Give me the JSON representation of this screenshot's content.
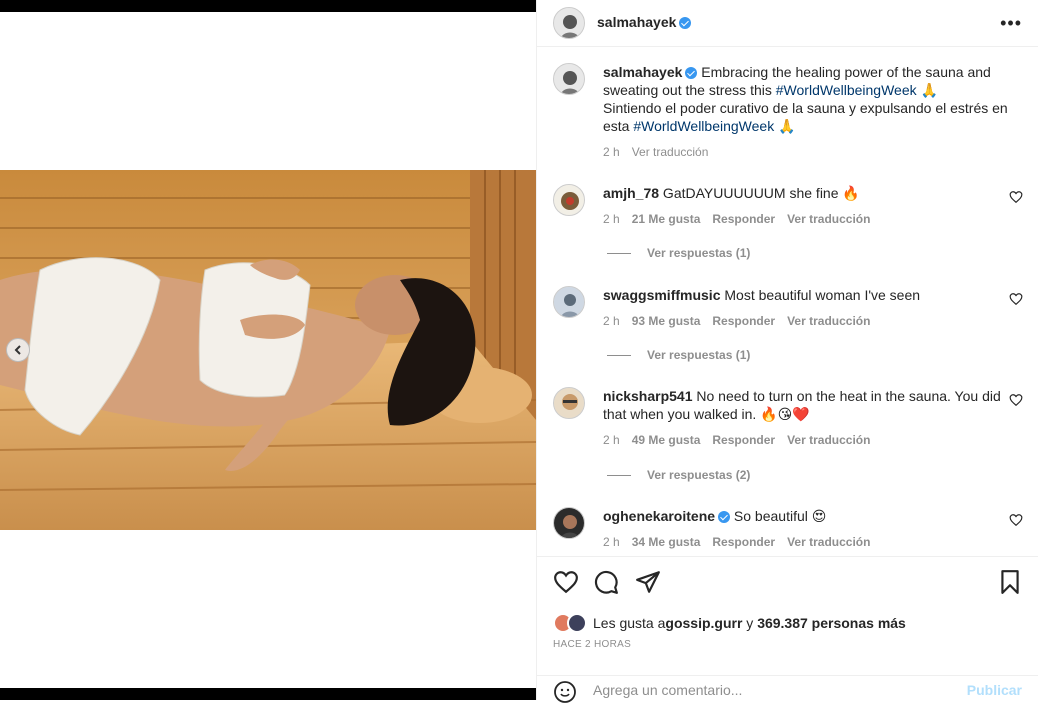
{
  "post": {
    "username": "salmahayek",
    "more_icon": "more-horizontal-icon",
    "caption_user": "salmahayek",
    "caption_text_1": " Embracing the healing power of the sauna and sweating out the stress this ",
    "caption_tag_1": "#WorldWellbeingWeek",
    "caption_emoji_1": " 🙏",
    "caption_text_2": "Sintiendo el poder curativo de la sauna y expulsando el estrés en esta ",
    "caption_tag_2": "#WorldWellbeingWeek",
    "caption_emoji_2": " 🙏",
    "caption_time": "2 h",
    "caption_translate": "Ver traducción"
  },
  "comments": [
    {
      "user": "amjh_78",
      "text": " GatDAYUUUUUUM she fine 🔥",
      "time": "2 h",
      "likes": "21 Me gusta",
      "reply": "Responder",
      "translate": "Ver traducción",
      "replies": "Ver respuestas (1)"
    },
    {
      "user": "swaggsmiffmusic",
      "text": " Most beautiful woman I've seen",
      "time": "2 h",
      "likes": "93 Me gusta",
      "reply": "Responder",
      "translate": "Ver traducción",
      "replies": "Ver respuestas (1)"
    },
    {
      "user": "nicksharp541",
      "text": " No need to turn on the heat in the sauna. You did that when you walked in. 🔥😘❤️",
      "time": "2 h",
      "likes": "49 Me gusta",
      "reply": "Responder",
      "translate": "Ver traducción",
      "replies": "Ver respuestas (2)"
    },
    {
      "user": "oghenekaroitene",
      "text": " So beautiful 😍",
      "time": "2 h",
      "likes": "34 Me gusta",
      "reply": "Responder",
      "translate": "Ver traducción"
    }
  ],
  "likes_line": {
    "prefix": "Les gusta a ",
    "user": "gossip.gurr",
    "mid": " y ",
    "count": "369.387 personas más"
  },
  "timestamp": "HACE 2 HORAS",
  "comment_input": {
    "placeholder": "Agrega un comentario...",
    "publish": "Publicar"
  },
  "colors": {
    "verified": "#3897f0",
    "link": "#00376b",
    "muted": "#8e8e8e",
    "publish": "#b2dffc"
  }
}
